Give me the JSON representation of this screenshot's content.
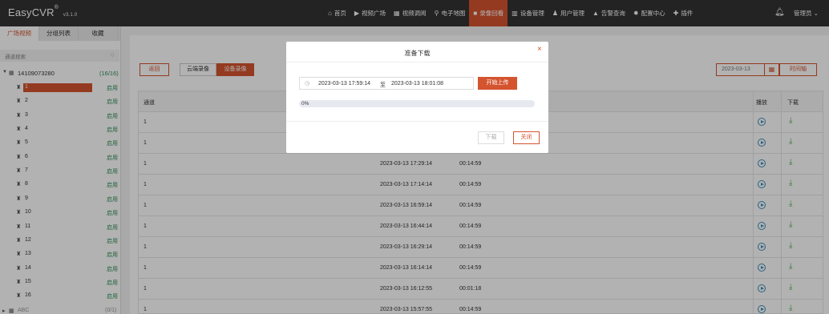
{
  "app": {
    "name": "EasyCVR",
    "reg": "®",
    "version": "v3.1.0"
  },
  "nav": [
    {
      "icon": "home-icon",
      "glyph": "⌂",
      "label": "首页",
      "active": false
    },
    {
      "icon": "play-circle-icon",
      "glyph": "▶",
      "label": "视频广场",
      "active": false
    },
    {
      "icon": "grid-icon",
      "glyph": "▦",
      "label": "视频调阅",
      "active": false
    },
    {
      "icon": "map-pin-icon",
      "glyph": "⚲",
      "label": "电子地图",
      "active": false
    },
    {
      "icon": "video-camera-icon",
      "glyph": "■",
      "label": "录像回看",
      "active": true
    },
    {
      "icon": "server-icon",
      "glyph": "▥",
      "label": "设备管理",
      "active": false
    },
    {
      "icon": "user-icon",
      "glyph": "♟",
      "label": "用户管理",
      "active": false
    },
    {
      "icon": "alarm-icon",
      "glyph": "▲",
      "label": "告警查询",
      "active": false
    },
    {
      "icon": "gear-icon",
      "glyph": "✹",
      "label": "配置中心",
      "active": false
    },
    {
      "icon": "puzzle-icon",
      "glyph": "✚",
      "label": "插件",
      "active": false
    }
  ],
  "header": {
    "bell_icon": "bell-icon",
    "user_label": "管理员",
    "user_caret": "⌄"
  },
  "sidebar": {
    "tabs": [
      "广场视频",
      "分组列表",
      "收藏"
    ],
    "search_placeholder": "通道搜索",
    "root": {
      "label": "14109073280",
      "count": "(16/16)"
    },
    "channels": [
      {
        "name": "1",
        "state": "启用"
      },
      {
        "name": "2",
        "state": "启用"
      },
      {
        "name": "3",
        "state": "启用"
      },
      {
        "name": "4",
        "state": "启用"
      },
      {
        "name": "5",
        "state": "启用"
      },
      {
        "name": "6",
        "state": "启用"
      },
      {
        "name": "7",
        "state": "启用"
      },
      {
        "name": "8",
        "state": "启用"
      },
      {
        "name": "9",
        "state": "启用"
      },
      {
        "name": "10",
        "state": "启用"
      },
      {
        "name": "11",
        "state": "启用"
      },
      {
        "name": "12",
        "state": "启用"
      },
      {
        "name": "13",
        "state": "启用"
      },
      {
        "name": "14",
        "state": "启用"
      },
      {
        "name": "15",
        "state": "启用"
      },
      {
        "name": "16",
        "state": "启用"
      }
    ],
    "next_group": {
      "label": "ABC",
      "count": "(0/1)"
    }
  },
  "toolbar": {
    "back": "返回",
    "cloud_recording": "云端录像",
    "device_recording": "设备录像",
    "date": "2023-03-13",
    "time_axis": "时间轴"
  },
  "table": {
    "headers": {
      "channel": "通道",
      "play": "播放",
      "download": "下载"
    },
    "rows": [
      {
        "channel": "1",
        "start": "",
        "duration": ""
      },
      {
        "channel": "1",
        "start": "",
        "duration": ""
      },
      {
        "channel": "1",
        "start": "2023-03-13 17:29:14",
        "duration": "00:14:59"
      },
      {
        "channel": "1",
        "start": "2023-03-13 17:14:14",
        "duration": "00:14:59"
      },
      {
        "channel": "1",
        "start": "2023-03-13 16:59:14",
        "duration": "00:14:59"
      },
      {
        "channel": "1",
        "start": "2023-03-13 16:44:14",
        "duration": "00:14:59"
      },
      {
        "channel": "1",
        "start": "2023-03-13 16:29:14",
        "duration": "00:14:59"
      },
      {
        "channel": "1",
        "start": "2023-03-13 16:14:14",
        "duration": "00:14:59"
      },
      {
        "channel": "1",
        "start": "2023-03-13 16:12:55",
        "duration": "00:01:18"
      },
      {
        "channel": "1",
        "start": "2023-03-13 15:57:55",
        "duration": "00:14:59"
      }
    ]
  },
  "modal": {
    "title": "准备下载",
    "close": "×",
    "range_start": "2023-03-13 17:59:14",
    "range_sep": "至",
    "range_end": "2023-03-13 18:01:08",
    "upload_button": "开始上传",
    "progress_text": "0%",
    "progress_value": 0,
    "download_button": "下载",
    "close_button": "关闭"
  },
  "colors": {
    "accent": "#d4542f",
    "topbar": "#333333",
    "enabled_green": "#2e8b57"
  }
}
